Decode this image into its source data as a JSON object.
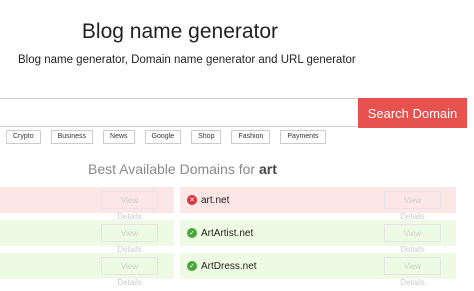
{
  "header": {
    "title": "Blog name generator",
    "subtitle": "Blog name generator, Domain name generator and URL generator"
  },
  "search": {
    "value": "",
    "placeholder": "",
    "button_label": "Search Domain"
  },
  "tags": [
    "Crypto",
    "Business",
    "News",
    "Google",
    "Shop",
    "Fashion",
    "Payments"
  ],
  "results": {
    "heading_prefix": "Best Available Domains for",
    "keyword": "art",
    "view_details_label": "View Details",
    "items": [
      {
        "domain": "art.net",
        "status": "taken",
        "status_icon": "cross-icon"
      },
      {
        "domain": "ArtArtist.net",
        "status": "available",
        "status_icon": "check-icon"
      },
      {
        "domain": "ArtDress.net",
        "status": "available",
        "status_icon": "check-icon"
      }
    ]
  },
  "colors": {
    "accent": "#e8514e",
    "taken_bg": "#fde6e6",
    "available_bg": "#eefbe4",
    "taken_icon": "#d9363b",
    "available_icon": "#47a83a"
  }
}
